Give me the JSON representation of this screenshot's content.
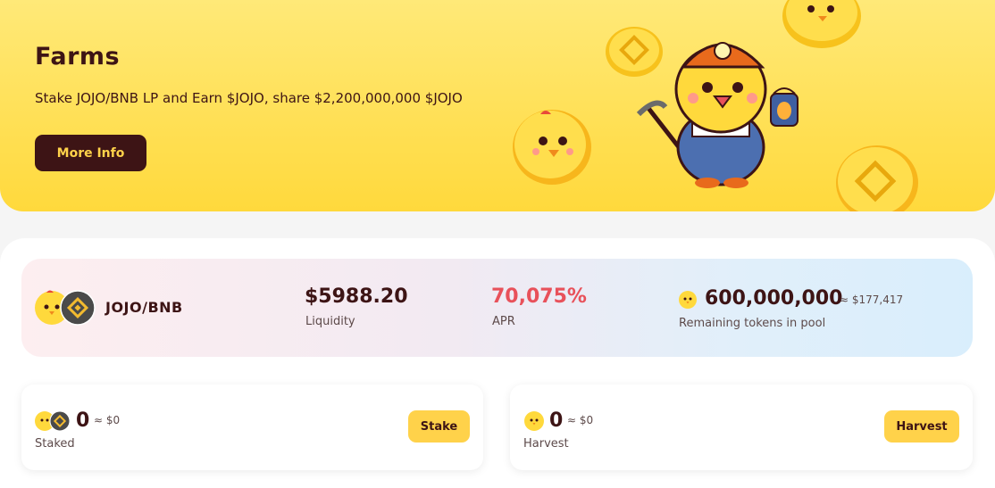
{
  "hero": {
    "title": "Farms",
    "subtitle": "Stake JOJO/BNB LP and Earn $JOJO, share $2,200,000,000 $JOJO",
    "more_info_label": "More Info"
  },
  "pool": {
    "pair_name": "JOJO/BNB",
    "liquidity_value": "$5988.20",
    "liquidity_label": "Liquidity",
    "apr_value": "70,075%",
    "apr_label": "APR",
    "remaining_value": "600,000,000",
    "remaining_approx": "≈ $177,417",
    "remaining_label": "Remaining tokens in pool"
  },
  "staked": {
    "value": "0",
    "approx": "≈ $0",
    "label": "Staked",
    "button_label": "Stake"
  },
  "harvest": {
    "value": "0",
    "approx": "≈ $0",
    "label": "Harvest",
    "button_label": "Harvest"
  },
  "colors": {
    "brand_dark": "#3d1415",
    "accent_yellow": "#ffd24a",
    "apr_red": "#e8515a"
  },
  "icons": [
    "jojo-token-icon",
    "bnb-token-icon",
    "chick-miner-illustration",
    "pickaxe-icon",
    "lantern-icon"
  ]
}
